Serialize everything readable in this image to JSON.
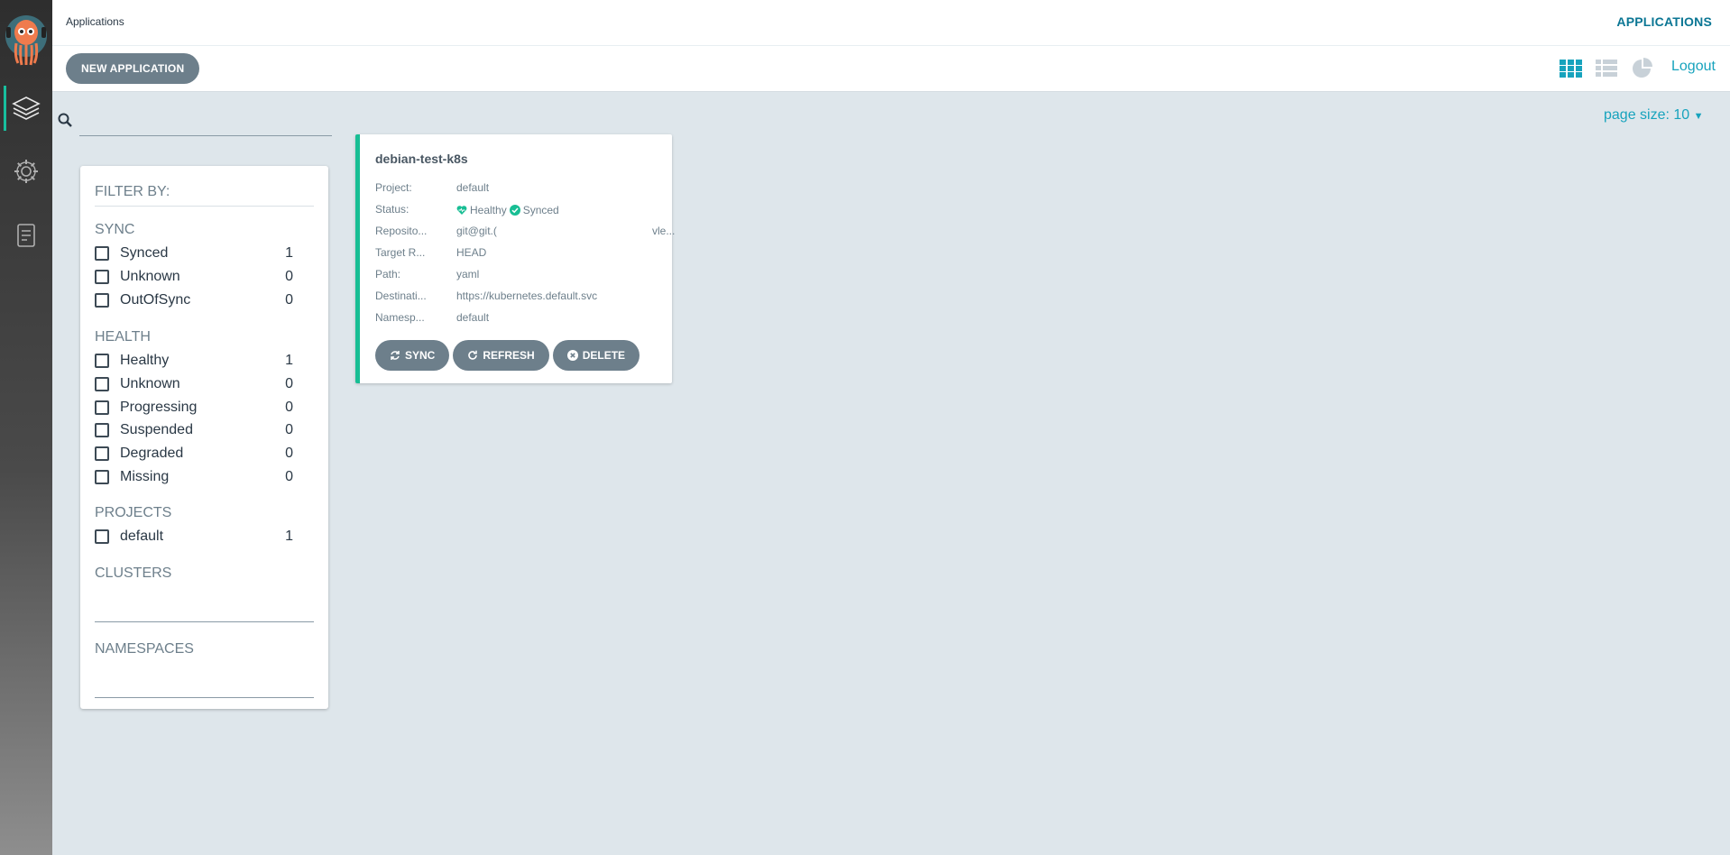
{
  "header": {
    "breadcrumb": "Applications",
    "title": "APPLICATIONS"
  },
  "toolbar": {
    "new_app_label": "NEW APPLICATION",
    "logout_label": "Logout",
    "page_size_label": "page size: 10"
  },
  "search": {
    "placeholder": ""
  },
  "filters": {
    "title": "FILTER BY:",
    "sync": {
      "title": "SYNC",
      "items": [
        {
          "label": "Synced",
          "count": "1"
        },
        {
          "label": "Unknown",
          "count": "0"
        },
        {
          "label": "OutOfSync",
          "count": "0"
        }
      ]
    },
    "health": {
      "title": "HEALTH",
      "items": [
        {
          "label": "Healthy",
          "count": "1"
        },
        {
          "label": "Unknown",
          "count": "0"
        },
        {
          "label": "Progressing",
          "count": "0"
        },
        {
          "label": "Suspended",
          "count": "0"
        },
        {
          "label": "Degraded",
          "count": "0"
        },
        {
          "label": "Missing",
          "count": "0"
        }
      ]
    },
    "projects": {
      "title": "PROJECTS",
      "items": [
        {
          "label": "default",
          "count": "1"
        }
      ]
    },
    "clusters": {
      "title": "CLUSTERS"
    },
    "namespaces": {
      "title": "NAMESPACES"
    }
  },
  "app_card": {
    "name": "debian-test-k8s",
    "fields": [
      {
        "key": "Project:",
        "value": "default"
      },
      {
        "key": "Status:",
        "health": "Healthy",
        "sync": "Synced"
      },
      {
        "key": "Reposito...",
        "value": "git@git.(",
        "value_tail": "vle..."
      },
      {
        "key": "Target R...",
        "value": "HEAD"
      },
      {
        "key": "Path:",
        "value": "yaml"
      },
      {
        "key": "Destinati...",
        "value": "https://kubernetes.default.svc"
      },
      {
        "key": "Namesp...",
        "value": "default"
      }
    ],
    "buttons": {
      "sync": "SYNC",
      "refresh": "REFRESH",
      "delete": "DELETE"
    }
  },
  "colors": {
    "accent": "#17a3bd",
    "healthy": "#18be94",
    "button": "#6d7f8b"
  }
}
